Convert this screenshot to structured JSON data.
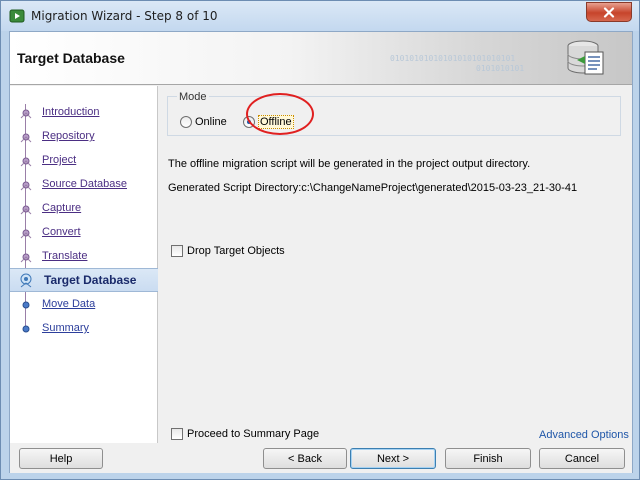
{
  "window": {
    "title": "Migration Wizard - Step 8 of 10"
  },
  "header": {
    "title": "Target Database",
    "decor_line1": "01010101010101010101010101",
    "decor_line2": "0101010101"
  },
  "nav": {
    "items": [
      {
        "label": "Introduction",
        "state": "done"
      },
      {
        "label": "Repository",
        "state": "done"
      },
      {
        "label": "Project",
        "state": "done"
      },
      {
        "label": "Source Database",
        "state": "done"
      },
      {
        "label": "Capture ",
        "state": "done"
      },
      {
        "label": "Convert",
        "state": "done"
      },
      {
        "label": "Translate",
        "state": "done"
      },
      {
        "label": "Target Database",
        "state": "current"
      },
      {
        "label": "Move Data",
        "state": "future"
      },
      {
        "label": "Summary",
        "state": "future"
      }
    ]
  },
  "mode": {
    "legend": "Mode",
    "online_label": "Online",
    "offline_label": "Offline",
    "selected": "Offline"
  },
  "description": "The offline migration script will be generated in the project output directory.",
  "script_directory": "Generated Script Directory:c:\\ChangeNameProject\\generated\\2015-03-23_21-30-41",
  "drop_target_label": "Drop Target Objects",
  "proceed_label": "Proceed to Summary Page",
  "advanced_options_label": "Advanced Options",
  "buttons": {
    "help": "Help",
    "back": "< Back",
    "next": "Next >",
    "finish": "Finish",
    "cancel": "Cancel"
  },
  "colors": {
    "accent_circle": "#e02020",
    "link": "#1f56a8",
    "current_step_bg": "#cadcf1"
  }
}
